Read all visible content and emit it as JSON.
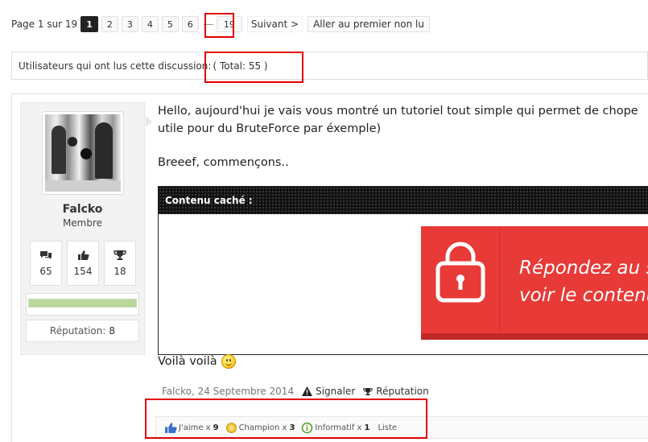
{
  "pagination": {
    "info": "Page 1 sur 19",
    "pages": [
      "1",
      "2",
      "3",
      "4",
      "5",
      "6"
    ],
    "current": "1",
    "last_page": "19",
    "next_label": "Suivant >",
    "first_unread_label": "Aller au premier non lu"
  },
  "readers": {
    "label": "Utilisateurs qui ont lus cette discussion:",
    "total": "( Total: 55 )"
  },
  "post": {
    "author": {
      "name": "Falcko",
      "title": "Membre",
      "stats": [
        {
          "icon": "comments-icon",
          "value": "65"
        },
        {
          "icon": "thumbs-up-icon",
          "value": "154"
        },
        {
          "icon": "trophy-icon",
          "value": "18"
        }
      ],
      "reputation_bar_fill": 1.0,
      "reputation_label": "Réputation:",
      "reputation_value": "8"
    },
    "message": {
      "line1": "Hello, aujourd'hui je vais vous montré un tutoriel tout simple qui permet de chope",
      "line2": "utile pour du BruteForce par éxemple)",
      "line3": "Breeef, commençons..",
      "hidden_header": "Contenu caché :",
      "hidden_cta_line1": "Répondez au s",
      "hidden_cta_line2": "voir le contenu",
      "after_text": "Voilà voilà"
    },
    "meta": {
      "author_date": "Falcko, 24 Septembre 2014",
      "report_label": "Signaler",
      "reputation_label": "Réputation"
    },
    "ratings": [
      {
        "icon": "thumbs-up-icon",
        "label": "J'aime x",
        "count": "9"
      },
      {
        "icon": "champion-medal-icon",
        "label": "Champion x",
        "count": "3"
      },
      {
        "icon": "info-icon",
        "label": "Informatif x",
        "count": "1"
      }
    ],
    "ratings_list_label": "Liste"
  },
  "colors": {
    "highlight": "#e00000",
    "cta_red": "#e83a36",
    "rep_bar": "#b7d89a"
  }
}
